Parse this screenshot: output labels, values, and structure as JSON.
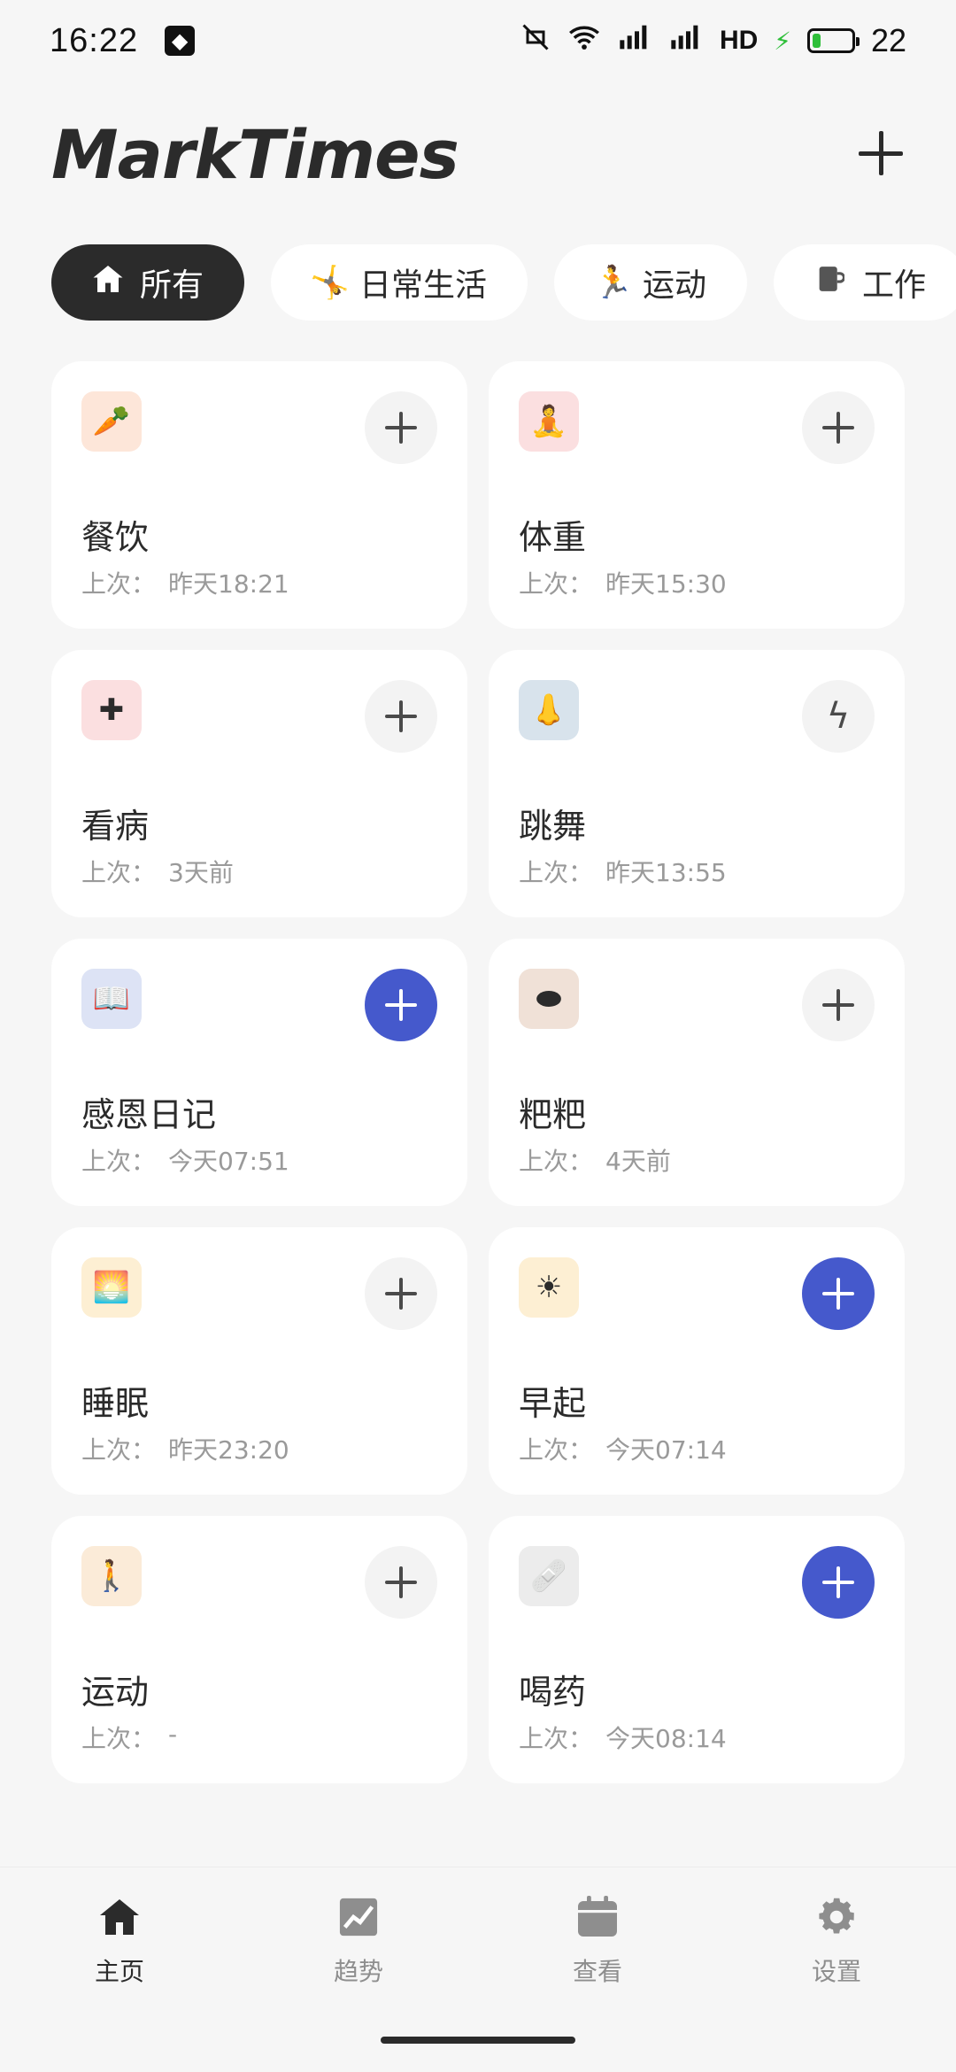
{
  "status_bar": {
    "time": "16:22",
    "network_label": "HD",
    "battery_percent": "22",
    "battery_level": 0.22
  },
  "app": {
    "title": "MarkTimes"
  },
  "categories": [
    {
      "label": "所有",
      "icon": "home-icon",
      "active": true
    },
    {
      "label": "日常生活",
      "icon": "person-stretch-icon",
      "active": false
    },
    {
      "label": "运动",
      "icon": "person-exercise-icon",
      "active": false
    },
    {
      "label": "工作",
      "icon": "mug-icon",
      "active": false
    }
  ],
  "last_prefix": "上次：",
  "cards": [
    {
      "name": "餐饮",
      "last": "昨天18:21",
      "icon": "carrot-icon",
      "glyph": "🥕",
      "icon_bg": "#fde6d9",
      "action": "plus",
      "highlight": false
    },
    {
      "name": "体重",
      "last": "昨天15:30",
      "icon": "meditation-icon",
      "glyph": "🧘",
      "icon_bg": "#fbdfe0",
      "action": "plus",
      "highlight": false
    },
    {
      "name": "看病",
      "last": "3天前",
      "icon": "medical-cross-icon",
      "glyph": "✚",
      "icon_bg": "#fbdfe0",
      "action": "plus",
      "highlight": false
    },
    {
      "name": "跳舞",
      "last": "昨天13:55",
      "icon": "nose-icon",
      "glyph": "👃",
      "icon_bg": "#d8e3ec",
      "action": "bolt",
      "highlight": false
    },
    {
      "name": "感恩日记",
      "last": "今天07:51",
      "icon": "book-icon",
      "glyph": "📖",
      "icon_bg": "#dde3f5",
      "action": "plus",
      "highlight": true
    },
    {
      "name": "粑粑",
      "last": "4天前",
      "icon": "poop-icon",
      "glyph": "⬬",
      "icon_bg": "#f0e1d7",
      "action": "plus",
      "highlight": false
    },
    {
      "name": "睡眠",
      "last": "昨天23:20",
      "icon": "sunrise-icon",
      "glyph": "🌅",
      "icon_bg": "#fdefd3",
      "action": "plus",
      "highlight": false
    },
    {
      "name": "早起",
      "last": "今天07:14",
      "icon": "sun-icon",
      "glyph": "☀",
      "icon_bg": "#fdefd3",
      "action": "plus",
      "highlight": true
    },
    {
      "name": "运动",
      "last": "-",
      "icon": "walking-icon",
      "glyph": "🚶",
      "icon_bg": "#fbebd8",
      "action": "plus",
      "highlight": false
    },
    {
      "name": "喝药",
      "last": "今天08:14",
      "icon": "bandage-icon",
      "glyph": "🩹",
      "icon_bg": "#ececec",
      "action": "plus",
      "highlight": true
    }
  ],
  "bottom_nav": [
    {
      "label": "主页",
      "icon": "home-icon",
      "active": true
    },
    {
      "label": "趋势",
      "icon": "trend-chart-icon",
      "active": false
    },
    {
      "label": "查看",
      "icon": "calendar-icon",
      "active": false
    },
    {
      "label": "设置",
      "icon": "gear-icon",
      "active": false
    }
  ],
  "colors": {
    "accent": "#4559cc",
    "dark": "#2b2b2b",
    "background": "#f6f6f6"
  }
}
